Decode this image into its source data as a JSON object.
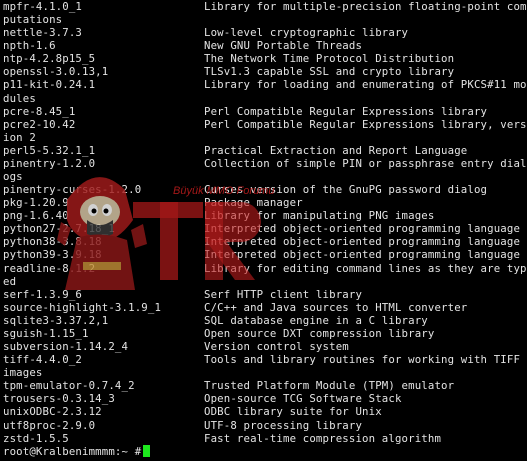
{
  "terminal": {
    "rows": [
      {
        "name": "mpfr-4.1.0_1",
        "desc": "Library for multiple-precision floating-point com"
      },
      {
        "name": "putations",
        "desc": ""
      },
      {
        "name": "nettle-3.7.3",
        "desc": "Low-level cryptographic library"
      },
      {
        "name": "npth-1.6",
        "desc": "New GNU Portable Threads"
      },
      {
        "name": "ntp-4.2.8p15_5",
        "desc": "The Network Time Protocol Distribution"
      },
      {
        "name": "openssl-3.0.13,1",
        "desc": "TLSv1.3 capable SSL and crypto library"
      },
      {
        "name": "p11-kit-0.24.1",
        "desc": "Library for loading and enumerating of PKCS#11 mo"
      },
      {
        "name": "dules",
        "desc": ""
      },
      {
        "name": "pcre-8.45_1",
        "desc": "Perl Compatible Regular Expressions library"
      },
      {
        "name": "pcre2-10.42",
        "desc": "Perl Compatible Regular Expressions library, vers"
      },
      {
        "name": "ion 2",
        "desc": ""
      },
      {
        "name": "perl5-5.32.1_1",
        "desc": "Practical Extraction and Report Language"
      },
      {
        "name": "pinentry-1.2.0",
        "desc": "Collection of simple PIN or passphrase entry dial"
      },
      {
        "name": "ogs",
        "desc": ""
      },
      {
        "name": "pinentry-curses-1.2.0",
        "desc": "Curses version of the GnuPG password dialog"
      },
      {
        "name": "pkg-1.20.9",
        "desc": "Package manager"
      },
      {
        "name": "png-1.6.40",
        "desc": "Library for manipulating PNG images"
      },
      {
        "name": "python27-2.7.18_1",
        "desc": "Interpreted object-oriented programming language"
      },
      {
        "name": "python38-3.8.18",
        "desc": "Interpreted object-oriented programming language"
      },
      {
        "name": "python39-3.9.18",
        "desc": "Interpreted object-oriented programming language"
      },
      {
        "name": "readline-8.1.2",
        "desc": "Library for editing command lines as they are typ"
      },
      {
        "name": "ed",
        "desc": ""
      },
      {
        "name": "serf-1.3.9_6",
        "desc": "Serf HTTP client library"
      },
      {
        "name": "source-highlight-3.1.9_1",
        "desc": "C/C++ and Java sources to HTML converter"
      },
      {
        "name": "sqlite3-3.37.2,1",
        "desc": "SQL database engine in a C library"
      },
      {
        "name": "sguish-1.15_1",
        "desc": "Open source DXT compression library"
      },
      {
        "name": "subversion-1.14.2_4",
        "desc": "Version control system"
      },
      {
        "name": "tiff-4.4.0_2",
        "desc": "Tools and library routines for working with TIFF"
      },
      {
        "name": "images",
        "desc": ""
      },
      {
        "name": "tpm-emulator-0.7.4_2",
        "desc": "Trusted Platform Module (TPM) emulator"
      },
      {
        "name": "trousers-0.3.14_3",
        "desc": "Open-source TCG Software Stack"
      },
      {
        "name": "unixODBC-2.3.12",
        "desc": "ODBC library suite for Unix"
      },
      {
        "name": "utf8proc-2.9.0",
        "desc": "UTF-8 processing library"
      },
      {
        "name": "zstd-1.5.5",
        "desc": "Fast real-time compression algorithm"
      }
    ],
    "prompt": "root@Kralbenimmmm:~ #"
  },
  "watermark": {
    "logo_text": "TR",
    "tagline": "Büyük MMO Forumu"
  },
  "colors": {
    "background": "#000000",
    "text": "#e4e4e4",
    "cursor": "#1de91d",
    "watermark_red": "#c81e1e"
  }
}
